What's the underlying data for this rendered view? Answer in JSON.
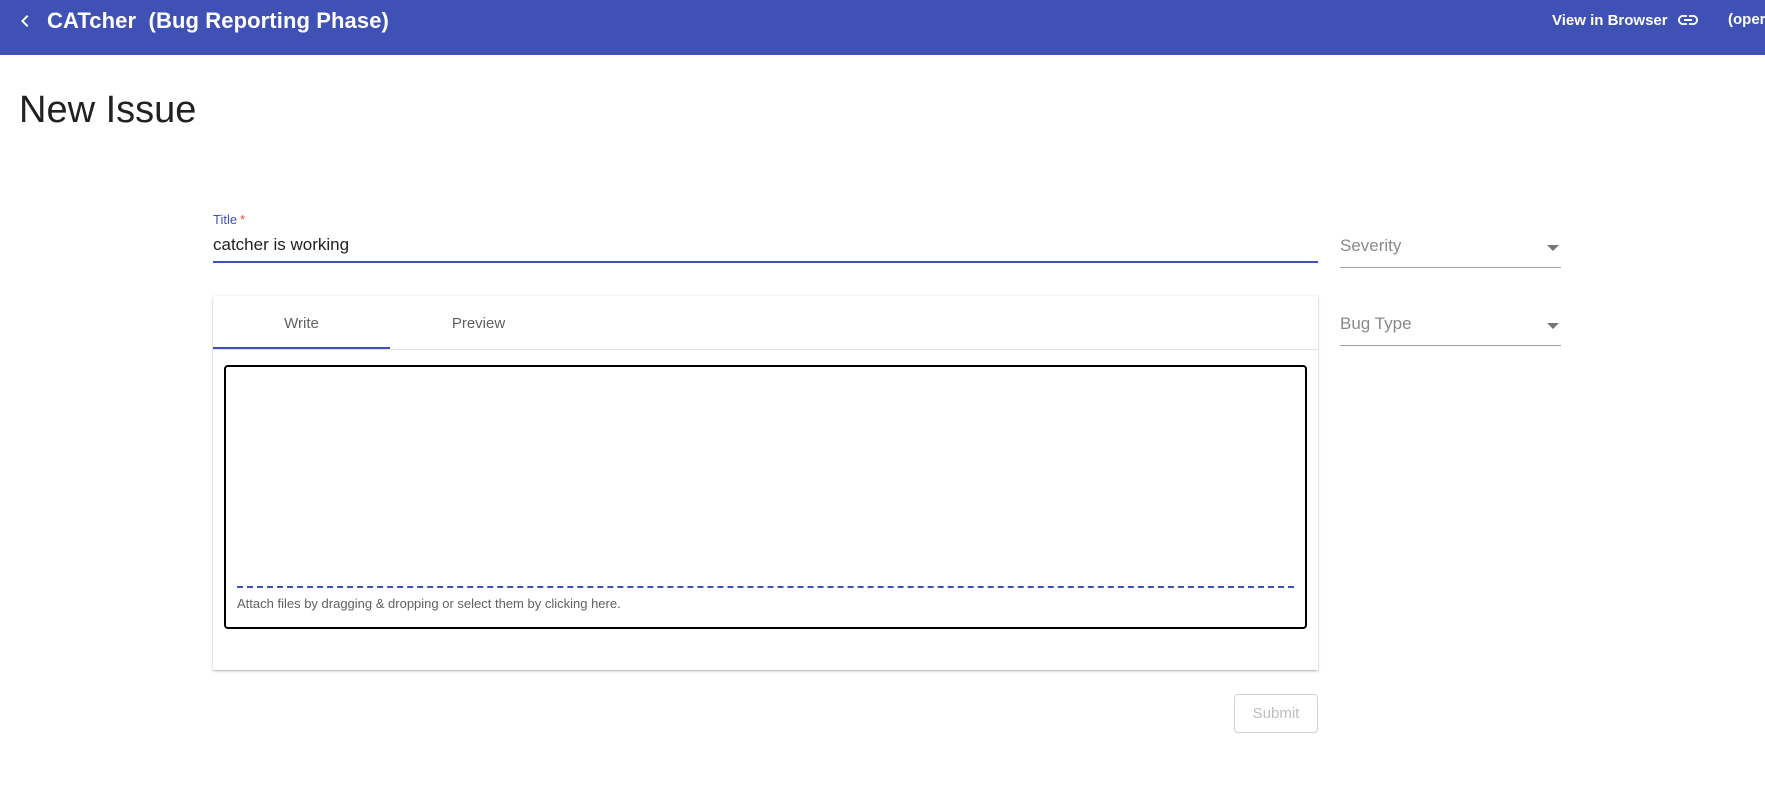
{
  "header": {
    "title": "CATcher  (Bug Reporting Phase)",
    "view_in_browser": "View in Browser",
    "overflow_text": "(oper"
  },
  "page": {
    "title": "New Issue"
  },
  "form": {
    "title_label": "Title",
    "required_mark": "*",
    "title_value": "catcher is working",
    "severity_placeholder": "Severity",
    "bug_type_placeholder": "Bug Type",
    "tabs": [
      {
        "label": "Write",
        "active": true
      },
      {
        "label": "Preview",
        "active": false
      }
    ],
    "description_value": "",
    "attach_hint": "Attach files by dragging & dropping or select them by clicking here.",
    "submit_label": "Submit",
    "submit_enabled": false
  },
  "icons": {
    "back": "chevron-left-icon",
    "link": "link-icon",
    "dropdown": "arrow-drop-down-icon"
  },
  "colors": {
    "primary": "#3f51b5",
    "required": "#f44336",
    "text": "#212121",
    "muted": "#8a8a8a",
    "background": "#ffffff"
  }
}
